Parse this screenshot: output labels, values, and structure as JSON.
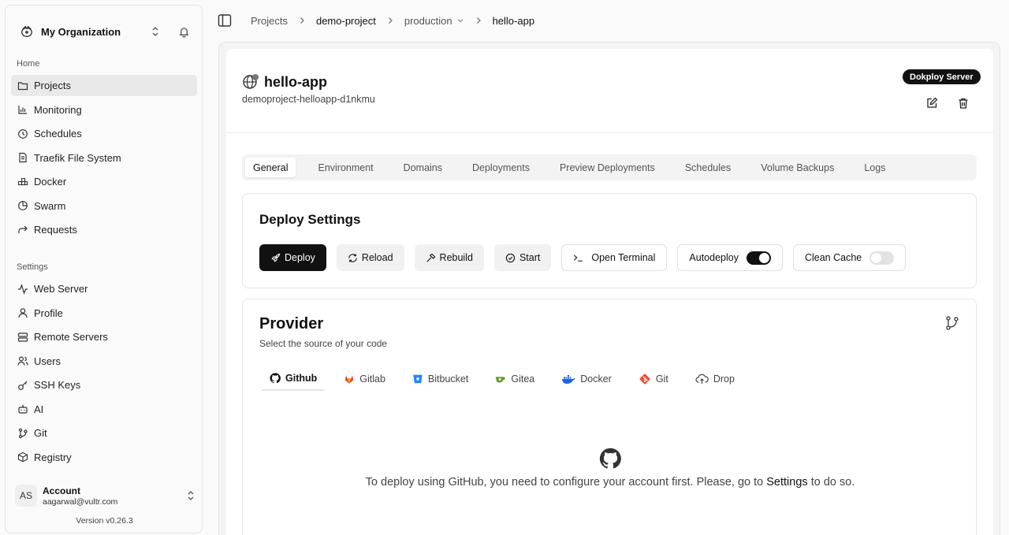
{
  "sidebar": {
    "org_name": "My Organization",
    "home_label": "Home",
    "home_items": [
      {
        "label": "Projects",
        "icon": "folder-icon"
      },
      {
        "label": "Monitoring",
        "icon": "chart-icon"
      },
      {
        "label": "Schedules",
        "icon": "clock-icon"
      },
      {
        "label": "Traefik File System",
        "icon": "file-icon"
      },
      {
        "label": "Docker",
        "icon": "docker-blocks-icon"
      },
      {
        "label": "Swarm",
        "icon": "pie-icon"
      },
      {
        "label": "Requests",
        "icon": "forward-arrow-icon"
      }
    ],
    "settings_label": "Settings",
    "settings_items": [
      {
        "label": "Web Server",
        "icon": "activity-icon"
      },
      {
        "label": "Profile",
        "icon": "user-icon"
      },
      {
        "label": "Remote Servers",
        "icon": "server-icon"
      },
      {
        "label": "Users",
        "icon": "users-icon"
      },
      {
        "label": "SSH Keys",
        "icon": "key-icon"
      },
      {
        "label": "AI",
        "icon": "bot-icon"
      },
      {
        "label": "Git",
        "icon": "git-branch-icon"
      },
      {
        "label": "Registry",
        "icon": "package-icon"
      }
    ],
    "account": {
      "initials": "AS",
      "name": "Account",
      "email": "aagarwal@vultr.com"
    },
    "version": "Version v0.26.3"
  },
  "breadcrumb": {
    "items": [
      "Projects",
      "demo-project",
      "production",
      "hello-app"
    ]
  },
  "app": {
    "name": "hello-app",
    "subtitle": "demoproject-helloapp-d1nkmu",
    "server_badge": "Dokploy Server"
  },
  "tabs": [
    "General",
    "Environment",
    "Domains",
    "Deployments",
    "Preview Deployments",
    "Schedules",
    "Volume Backups",
    "Logs"
  ],
  "deploy": {
    "title": "Deploy Settings",
    "deploy_label": "Deploy",
    "reload_label": "Reload",
    "rebuild_label": "Rebuild",
    "start_label": "Start",
    "terminal_label": "Open Terminal",
    "autodeploy_label": "Autodeploy",
    "clean_cache_label": "Clean Cache"
  },
  "provider": {
    "title": "Provider",
    "subtitle": "Select the source of your code",
    "tabs": [
      "Github",
      "Gitlab",
      "Bitbucket",
      "Gitea",
      "Docker",
      "Git",
      "Drop"
    ],
    "message_pre": "To deploy using GitHub, you need to configure your account first. Please, go to",
    "message_link": "Settings",
    "message_post": "to do so."
  },
  "colors": {
    "gitlab": "#e2432a",
    "bitbucket": "#2684ff",
    "gitea": "#609926",
    "docker": "#1d63ed",
    "git": "#f05033"
  }
}
